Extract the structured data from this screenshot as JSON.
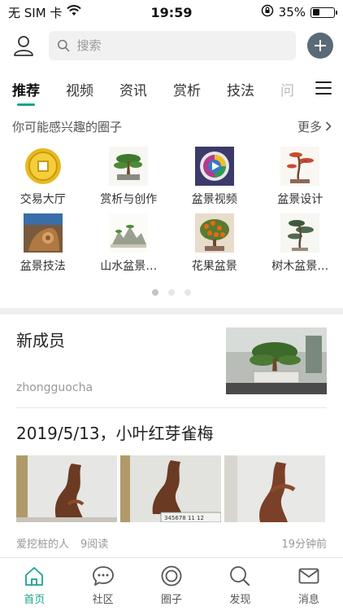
{
  "status": {
    "carrier": "无 SIM 卡",
    "time": "19:59",
    "battery": "35%",
    "battery_level": 0.35
  },
  "header": {
    "search_placeholder": "搜索"
  },
  "tabs": [
    {
      "label": "推荐",
      "active": true
    },
    {
      "label": "视频"
    },
    {
      "label": "资讯"
    },
    {
      "label": "赏析"
    },
    {
      "label": "技法"
    },
    {
      "label": "问"
    }
  ],
  "circles": {
    "heading": "你可能感兴趣的圈子",
    "more": "更多",
    "items": [
      {
        "label": "交易大厅",
        "icon": "coin-icon"
      },
      {
        "label": "赏析与创作",
        "icon": "bonsai-icon"
      },
      {
        "label": "盆景视频",
        "icon": "video-icon"
      },
      {
        "label": "盆景设计",
        "icon": "sketch-tree-icon"
      },
      {
        "label": "盆景技法",
        "icon": "stump-icon"
      },
      {
        "label": "山水盆景…",
        "icon": "landscape-icon"
      },
      {
        "label": "花果盆景",
        "icon": "fruit-tree-icon"
      },
      {
        "label": "树木盆景…",
        "icon": "pine-tree-icon"
      }
    ],
    "page_count": 3,
    "active_page": 0
  },
  "posts": [
    {
      "title": "新成员",
      "author": "zhongguocha"
    },
    {
      "title": "2019/5/13，小叶红芽雀梅",
      "author": "爱挖桩的人",
      "reads": "9阅读",
      "time": "19分钟前",
      "ruler_text": "345678 11 12"
    }
  ],
  "bottom_nav": [
    {
      "label": "首页",
      "icon": "home-icon",
      "active": true
    },
    {
      "label": "社区",
      "icon": "chat-icon"
    },
    {
      "label": "圈子",
      "icon": "circle-icon"
    },
    {
      "label": "发现",
      "icon": "search-icon"
    },
    {
      "label": "消息",
      "icon": "mail-icon"
    }
  ],
  "colors": {
    "accent": "#1aa38c",
    "add_button": "#5a6a76"
  }
}
